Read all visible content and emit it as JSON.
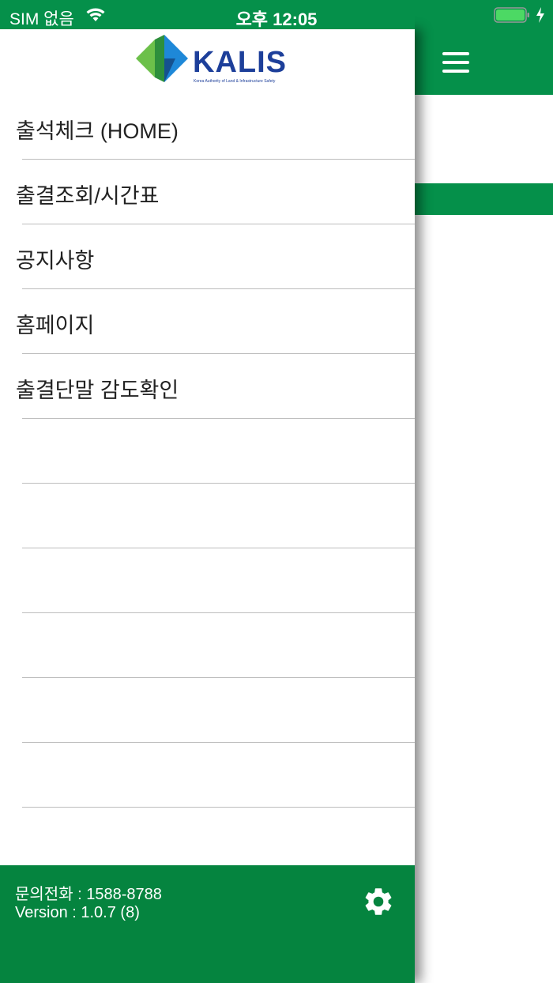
{
  "status_bar": {
    "carrier": "SIM 없음",
    "time": "오후 12:05",
    "icons": [
      "wifi-icon",
      "battery-icon",
      "charging-bolt-icon"
    ]
  },
  "colors": {
    "brand_green": "#05904a",
    "footer_green": "#05843f",
    "logo_blue": "#1d3f9a"
  },
  "logo": {
    "name": "KALIS",
    "subtitle": "Korea Authority of Land & Infrastructure Safety"
  },
  "menu": {
    "items": [
      {
        "label": "출석체크 (HOME)"
      },
      {
        "label": "출결조회/시간표"
      },
      {
        "label": "공지사항"
      },
      {
        "label": "홈페이지"
      },
      {
        "label": "출결단말 감도확인"
      },
      {
        "label": ""
      },
      {
        "label": ""
      },
      {
        "label": ""
      },
      {
        "label": ""
      },
      {
        "label": ""
      },
      {
        "label": ""
      },
      {
        "label": ""
      }
    ]
  },
  "footer": {
    "phone": "문의전화 :  1588-8788",
    "version": "Version :  1.0.7 (8)"
  },
  "main": {
    "menu_icon": "hamburger-menu-icon"
  }
}
